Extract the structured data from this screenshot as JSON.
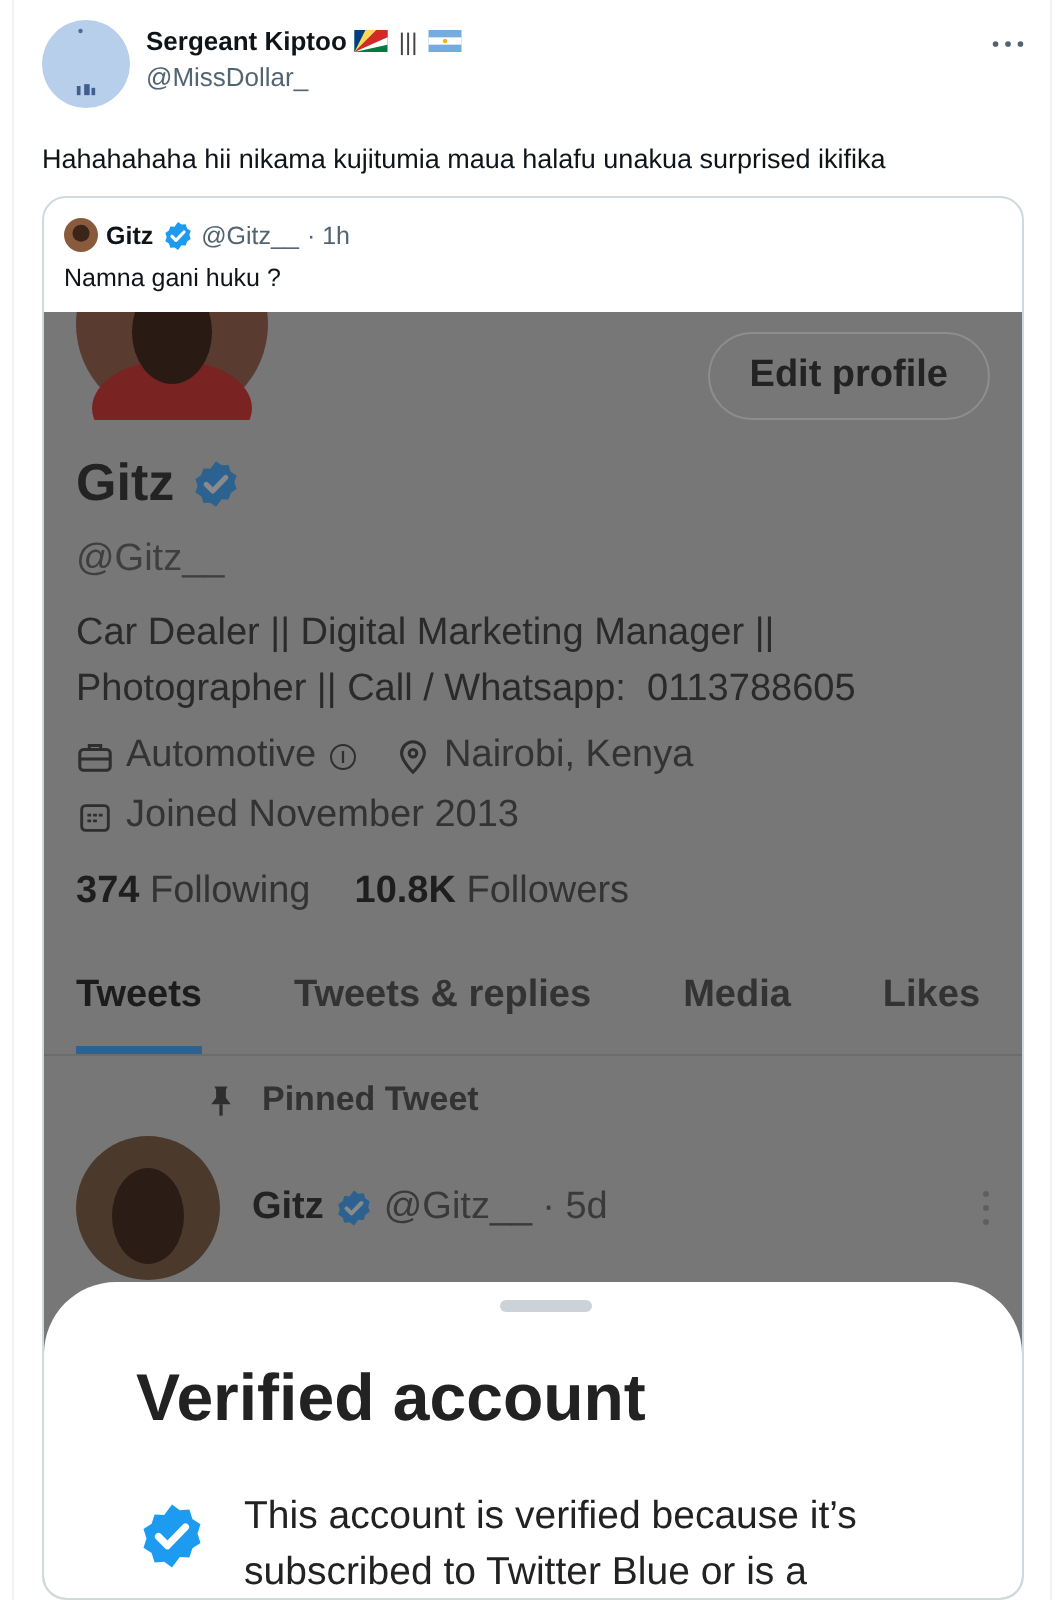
{
  "tweet": {
    "author_name": "Sergeant Kiptoo",
    "name_suffix": "|||",
    "handle": "@MissDollar_",
    "text": "Hahahahaha hii nikama kujitumia maua halafu unakua surprised ikifika"
  },
  "quoted_tweet": {
    "author_name": "Gitz",
    "verified": true,
    "handle": "@Gitz__",
    "time": "· 1h",
    "text": "Namna gani huku ?"
  },
  "screenshot": {
    "edit_button": "Edit profile",
    "name": "Gitz",
    "verified": true,
    "handle": "@Gitz__",
    "bio": "Car Dealer || Digital Marketing Manager || Photographer || Call / Whatsapp:  0113788605",
    "category": "Automotive",
    "location": "Nairobi, Kenya",
    "joined": "Joined November 2013",
    "stats": [
      {
        "count": "374",
        "label": "Following"
      },
      {
        "count": "10.8K",
        "label": "Followers"
      }
    ],
    "tabs": [
      {
        "label": "Tweets",
        "selected": true
      },
      {
        "label": "Tweets & replies",
        "selected": false
      },
      {
        "label": "Media",
        "selected": false
      },
      {
        "label": "Likes",
        "selected": false
      }
    ],
    "pinned_label": "Pinned Tweet",
    "pinned_tweet": {
      "author_name": "Gitz",
      "verified": true,
      "handle": "@Gitz__",
      "time": "· 5d"
    },
    "sheet": {
      "title": "Verified account",
      "text": "This account is verified because it’s subscribed to Twitter Blue or is a"
    }
  }
}
